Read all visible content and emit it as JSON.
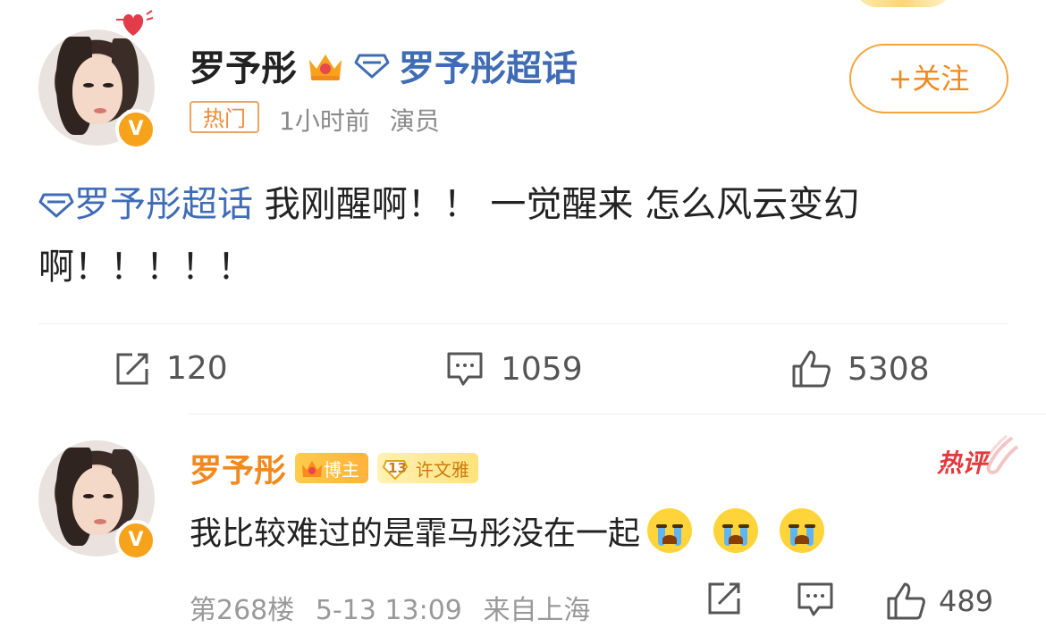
{
  "post": {
    "author": "罗予彤",
    "topic_label": "罗予彤超话",
    "tag": "热门",
    "time": "1小时前",
    "role": "演员",
    "follow_label": "+关注",
    "topic_inline": "罗予彤超话",
    "body": " 我刚醒啊！！ 一觉醒来 怎么风云变幻啊！！！！！"
  },
  "actions": {
    "repost_count": "120",
    "comment_count": "1059",
    "like_count": "5308"
  },
  "comment": {
    "author": "罗予彤",
    "badge_blogger": "博主",
    "fan_level": "13",
    "fan_name": "许文雅",
    "hot_label": "热评",
    "text": "我比较难过的是霏马彤没在一起",
    "floor": "第268楼",
    "date": "5-13 13:09",
    "source": "来自上海",
    "like_count": "489"
  },
  "colors": {
    "accent": "#f08a1f",
    "link": "#3f6cb4",
    "hot": "#e4393c"
  }
}
